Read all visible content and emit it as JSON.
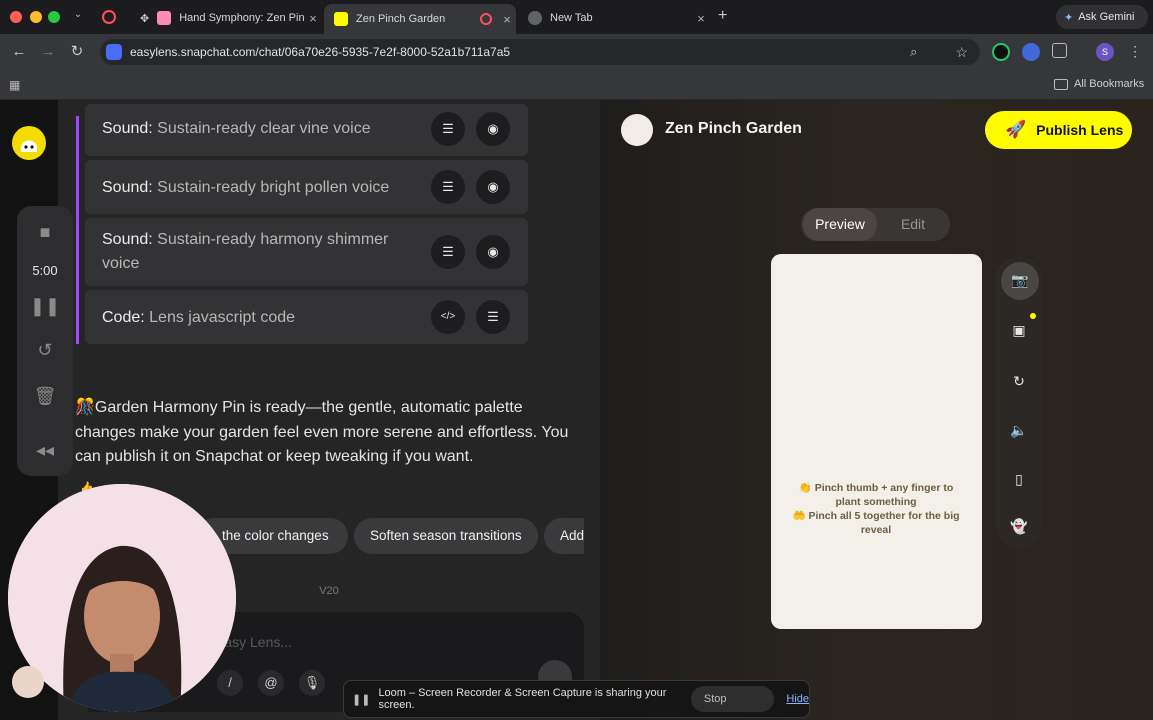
{
  "browser": {
    "tabs": [
      {
        "title": "Hand Symphony: Zen Pinch",
        "active": false
      },
      {
        "title": "Zen Pinch Garden",
        "active": true
      },
      {
        "title": "New Tab",
        "active": false
      }
    ],
    "ask_gemini": "Ask Gemini",
    "url": "easylens.snapchat.com/chat/06a70e26-5935-7e2f-8000-52a1b711a7a5",
    "profile_initial": "S",
    "bookmarks_label": "All Bookmarks"
  },
  "loom_sidebar": {
    "timer": "5:00"
  },
  "chat": {
    "cards": [
      {
        "type": "Sound:",
        "desc": "Sustain-ready clear vine voice"
      },
      {
        "type": "Sound:",
        "desc": "Sustain-ready bright pollen voice"
      },
      {
        "type": "Sound:",
        "desc": "Sustain-ready harmony shimmer voice"
      },
      {
        "type": "Code:",
        "desc": "Lens javascript code"
      }
    ],
    "code_button": "</>",
    "message": "Garden Harmony Pin is ready—the gentle, automatic palette changes make your garden feel even more serene and effortless. You can publish it on Snapchat or keep tweaking if you want.",
    "suggestions": [
      "the color changes",
      "Soften season transitions",
      "Add"
    ],
    "version": "V20",
    "composer_placeholder": "Easy Lens...",
    "composer_tools": [
      "/",
      "@"
    ]
  },
  "preview": {
    "lens_title": "Zen Pinch Garden",
    "publish_label": "Publish Lens",
    "tabs": [
      "Preview",
      "Edit"
    ],
    "instructions": [
      "👏 Pinch thumb + any finger to plant something",
      "🤲 Pinch all 5 together for the big reveal"
    ]
  },
  "loom_bar": {
    "message": "Loom – Screen Recorder & Screen Capture is sharing your screen.",
    "stop": "Stop sharing",
    "hide": "Hide"
  },
  "colors": {
    "accent_purple": "#a347ff",
    "publish_yellow": "#fffc00",
    "snap_logo": "#f5dc00"
  }
}
